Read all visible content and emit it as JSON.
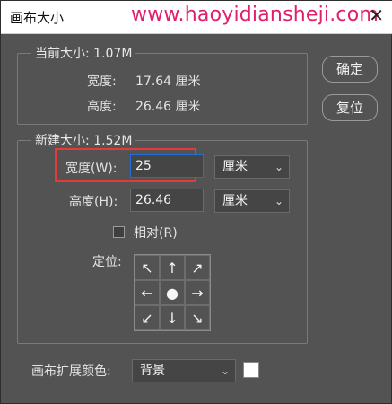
{
  "window": {
    "title": "画布大小",
    "watermark": "www.haoyidiansheji.com",
    "close_glyph": "✕"
  },
  "current_size": {
    "legend": "当前大小: 1.07M",
    "width_label": "宽度:",
    "width_value": "17.64 厘米",
    "height_label": "高度:",
    "height_value": "26.46 厘米"
  },
  "buttons": {
    "ok": "确定",
    "reset": "复位"
  },
  "new_size": {
    "legend": "新建大小: 1.52M",
    "width_label": "宽度(W):",
    "width_value": "25",
    "width_unit": "厘米",
    "height_label": "高度(H):",
    "height_value": "26.46",
    "height_unit": "厘米",
    "relative_label": "相对(R)",
    "relative_checked": false,
    "anchor_label": "定位:",
    "anchor_grid": [
      "↖",
      "↑",
      "↗",
      "←",
      "●",
      "→",
      "↙",
      "↓",
      "↘"
    ]
  },
  "extension_color": {
    "label": "画布扩展颜色:",
    "value": "背景",
    "swatch_color": "#ffffff"
  },
  "colors": {
    "background": "#535353",
    "highlight": "#e43a3a",
    "watermark": "#e0206a",
    "focus": "#1f6fd6"
  },
  "icons": {
    "dropdown": "chevron-down-icon",
    "close": "close-icon"
  }
}
